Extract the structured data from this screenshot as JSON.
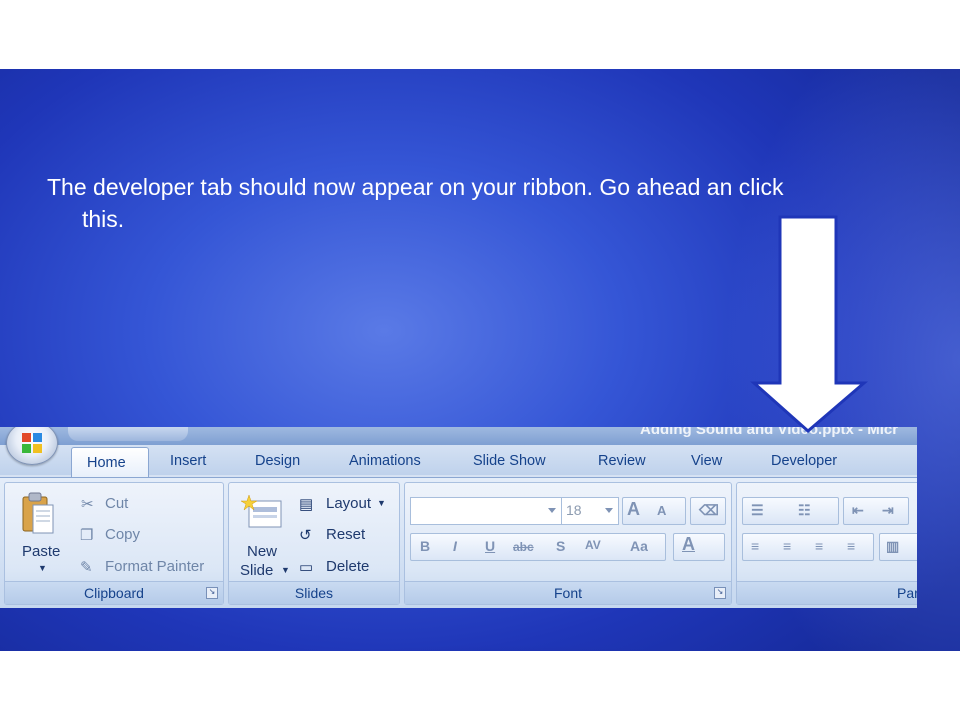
{
  "slide": {
    "instruction_line1": "The developer tab should now appear on your ribbon.  Go ahead an click",
    "instruction_line2": "this."
  },
  "window": {
    "title_fragment": "Adding Sound and Video.pptx - Micr"
  },
  "ribbon": {
    "tabs": [
      {
        "label": "Home",
        "selected": true
      },
      {
        "label": "Insert"
      },
      {
        "label": "Design"
      },
      {
        "label": "Animations"
      },
      {
        "label": "Slide Show"
      },
      {
        "label": "Review"
      },
      {
        "label": "View"
      },
      {
        "label": "Developer"
      }
    ],
    "clipboard": {
      "paste": "Paste",
      "cut": "Cut",
      "copy": "Copy",
      "format_painter": "Format Painter",
      "group_label": "Clipboard"
    },
    "slides": {
      "new_slide_line1": "New",
      "new_slide_line2": "Slide",
      "layout": "Layout",
      "reset": "Reset",
      "delete": "Delete",
      "group_label": "Slides"
    },
    "font": {
      "font_size": "18",
      "group_label": "Font"
    },
    "paragraph": {
      "group_label_fragment": "Par"
    }
  },
  "colors": {
    "slide_blue": "#2a46c8",
    "ribbon_text": "#15428b",
    "arrow_fill": "#ffffff",
    "arrow_stroke": "#1f36b8"
  }
}
